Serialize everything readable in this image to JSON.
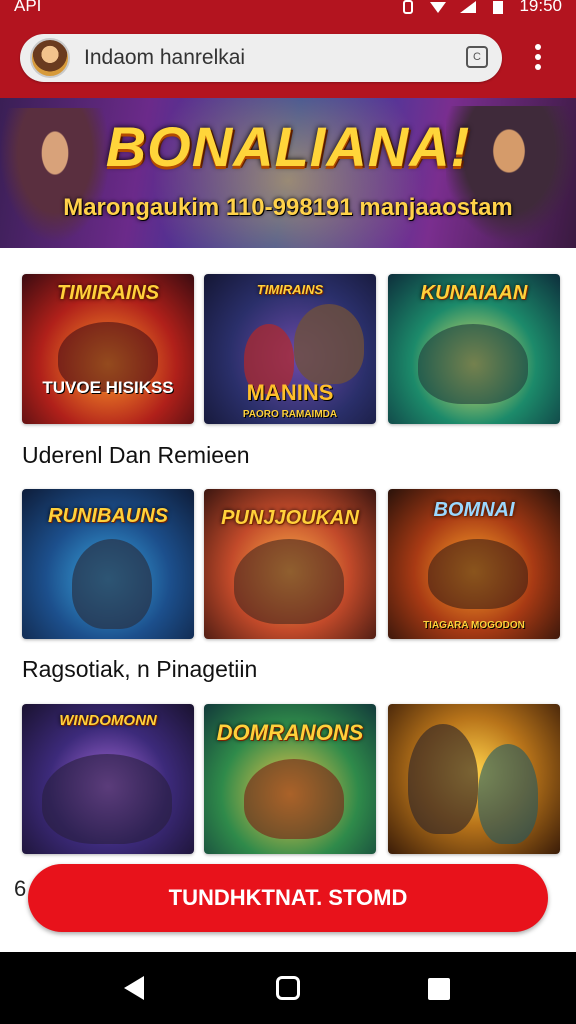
{
  "status_bar": {
    "left_text": "API",
    "time": "19:50"
  },
  "browser": {
    "address_text": "Indaom hanrelkai",
    "tab_icon_label": "C",
    "menu_icon": "more-vert-icon"
  },
  "banner": {
    "title": "BONALIANA!",
    "subtitle": "Marongaukim 110-998191 manjaaostam"
  },
  "sections": [
    {
      "label": "Uderenl Dan Remieen",
      "tiles": [
        {
          "title": "TIMIRAINS",
          "sub": "TUVOE HISIKSS",
          "caption": ""
        },
        {
          "title": "TIMIRAINS",
          "sub": "MANINS",
          "caption": "PAORO RAMAIMDA"
        },
        {
          "title": "KUNAIAAN",
          "sub": "",
          "caption": ""
        }
      ]
    },
    {
      "label": "Ragsotiak, n Pinagetiin",
      "tiles": [
        {
          "title": "RUNIBAUNS",
          "sub": "",
          "caption": ""
        },
        {
          "title": "PUNJJOUKAN",
          "sub": "",
          "caption": ""
        },
        {
          "title": "BOMNAI",
          "sub": "",
          "caption": "TIAGARA MOGODON"
        }
      ]
    },
    {
      "label": "",
      "tiles": [
        {
          "title": "WINDOMONN",
          "sub": "",
          "caption": ""
        },
        {
          "title": "DOMRANONS",
          "sub": "",
          "caption": ""
        },
        {
          "title": "",
          "sub": "",
          "caption": ""
        }
      ]
    }
  ],
  "cta": {
    "label": "TUNDHKTNAT. STOMD"
  },
  "peek_text": "6",
  "colors": {
    "brand_red": "#b3141f",
    "cta_red": "#e8121b",
    "title_gold": "#ffd13b"
  }
}
